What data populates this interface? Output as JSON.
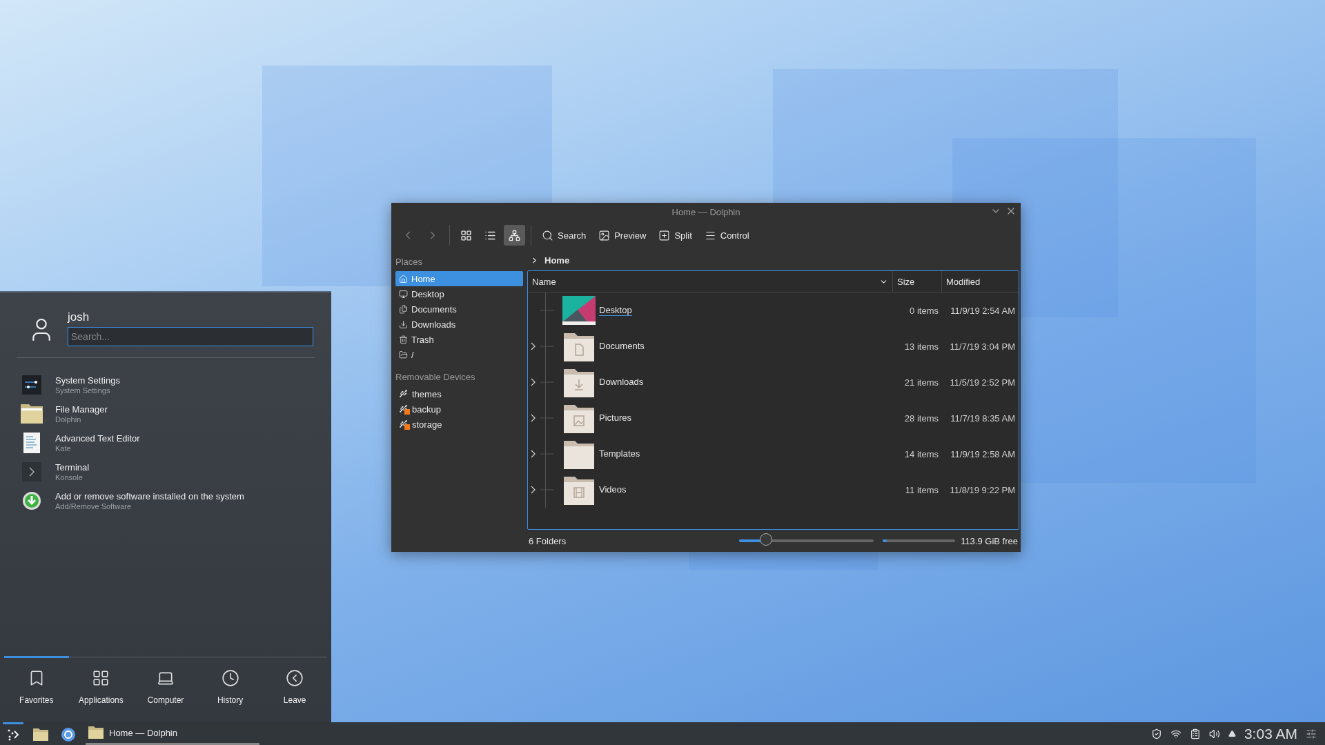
{
  "file_manager": {
    "title": "Home — Dolphin",
    "view_modes": [
      {
        "selected": false
      },
      {
        "selected": false
      },
      {
        "selected": true
      }
    ],
    "toolbar_buttons": [
      "Search",
      "Preview",
      "Split",
      "Control"
    ],
    "places": {
      "heading": "Places",
      "items": [
        {
          "label": "Home",
          "selected": true
        },
        {
          "label": "Desktop",
          "selected": false
        },
        {
          "label": "Documents",
          "selected": false
        },
        {
          "label": "Downloads",
          "selected": false
        },
        {
          "label": "Trash",
          "selected": false
        },
        {
          "label": "/",
          "selected": false
        }
      ]
    },
    "devices": {
      "heading": "Removable Devices",
      "items": [
        {
          "label": "themes",
          "mounted": true
        },
        {
          "label": "backup",
          "mounted": false
        },
        {
          "label": "storage",
          "mounted": false
        }
      ]
    },
    "breadcrumb": "Home",
    "columns": [
      "Name",
      "Size",
      "Modified"
    ],
    "rows": [
      {
        "name": "Desktop",
        "size": "0 items",
        "modified": "11/9/19 2:54 AM",
        "expandable": false,
        "hovered": true
      },
      {
        "name": "Documents",
        "size": "13 items",
        "modified": "11/7/19 3:04 PM",
        "expandable": true,
        "hovered": false
      },
      {
        "name": "Downloads",
        "size": "21 items",
        "modified": "11/5/19 2:52 PM",
        "expandable": true,
        "hovered": false
      },
      {
        "name": "Pictures",
        "size": "28 items",
        "modified": "11/7/19 8:35 AM",
        "expandable": true,
        "hovered": false
      },
      {
        "name": "Templates",
        "size": "14 items",
        "modified": "11/9/19 2:58 AM",
        "expandable": true,
        "hovered": false
      },
      {
        "name": "Videos",
        "size": "11 items",
        "modified": "11/8/19 9:22 PM",
        "expandable": true,
        "hovered": false
      }
    ],
    "status": "6 Folders",
    "zoom_slider": {
      "level": 0.2
    },
    "space_bar": {
      "level": 0.06
    },
    "free_space": "113.9 GiB free"
  },
  "launcher": {
    "user": "josh",
    "search": {
      "placeholder": "Search..."
    },
    "items": [
      {
        "title": "System Settings",
        "subtitle": "System Settings"
      },
      {
        "title": "File Manager",
        "subtitle": "Dolphin"
      },
      {
        "title": "Advanced Text Editor",
        "subtitle": "Kate"
      },
      {
        "title": "Terminal",
        "subtitle": "Konsole"
      },
      {
        "title": "Add or remove software installed on the system",
        "subtitle": "Add/Remove Software"
      }
    ],
    "tabs": [
      {
        "label": "Favorites",
        "selected": true
      },
      {
        "label": "Applications",
        "selected": false
      },
      {
        "label": "Computer",
        "selected": false
      },
      {
        "label": "History",
        "selected": false
      },
      {
        "label": "Leave",
        "selected": false
      }
    ]
  },
  "taskbar": {
    "launcher_open": true,
    "task": {
      "label": "Home — Dolphin",
      "active": true
    },
    "clock": "3:03 AM"
  }
}
